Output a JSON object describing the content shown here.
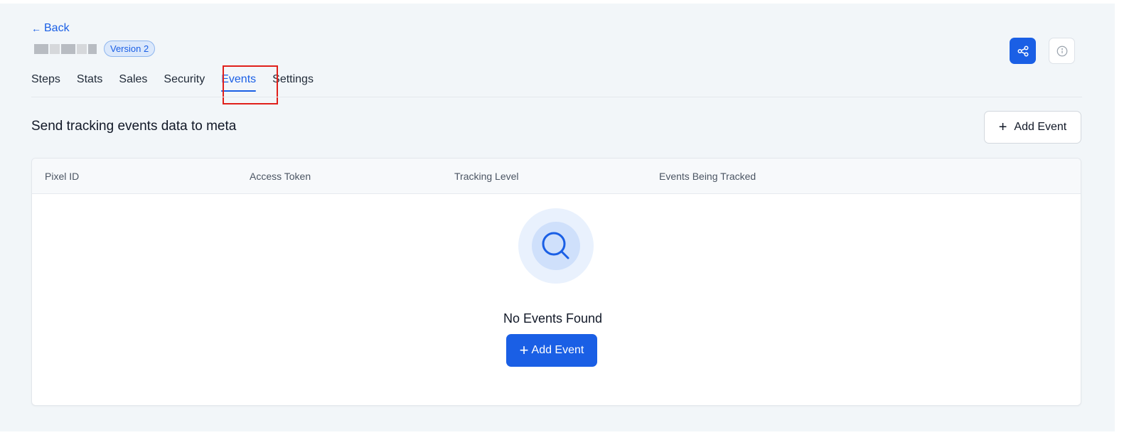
{
  "nav": {
    "back_label": "Back",
    "back_arrow": "←"
  },
  "header": {
    "version_badge": "Version 2"
  },
  "tabs": [
    {
      "label": "Steps",
      "active": false
    },
    {
      "label": "Stats",
      "active": false
    },
    {
      "label": "Sales",
      "active": false
    },
    {
      "label": "Security",
      "active": false
    },
    {
      "label": "Events",
      "active": true
    },
    {
      "label": "Settings",
      "active": false
    }
  ],
  "section": {
    "title": "Send tracking events data to meta",
    "add_button_label": "Add Event"
  },
  "table": {
    "columns": [
      "Pixel ID",
      "Access Token",
      "Tracking Level",
      "Events Being Tracked"
    ]
  },
  "empty_state": {
    "message": "No Events Found",
    "button_label": "Add Event"
  },
  "icons": {
    "share": "share-icon",
    "info": "info-icon",
    "search": "search-icon",
    "plus": "plus-icon"
  },
  "colors": {
    "accent": "#1a5fe5",
    "highlight": "#e0201b",
    "background": "#f2f6f9"
  }
}
